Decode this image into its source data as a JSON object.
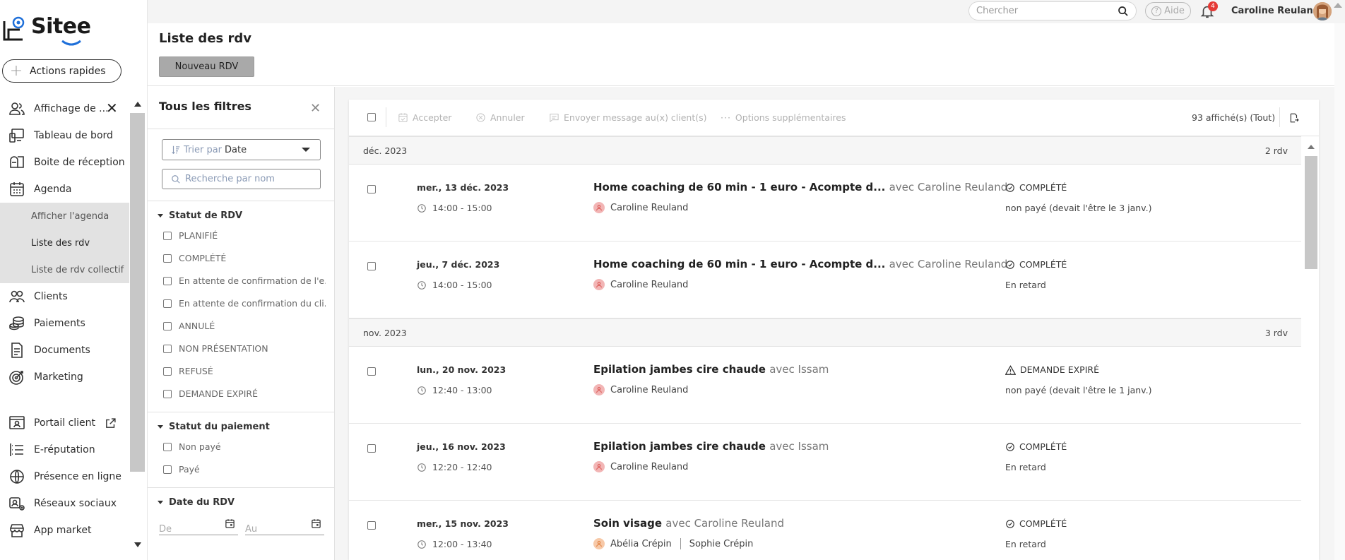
{
  "app": {
    "brand": "Sitee"
  },
  "sidebar": {
    "quick_actions": "Actions rapides",
    "items": [
      {
        "label": "Affichage de ...",
        "icon": "users-icon",
        "closable": true
      },
      {
        "label": "Tableau de bord",
        "icon": "dashboard-icon"
      },
      {
        "label": "Boite de réception",
        "icon": "mailbox-icon"
      },
      {
        "label": "Agenda",
        "icon": "calendar-icon"
      },
      {
        "label": "Clients",
        "icon": "clients-icon"
      },
      {
        "label": "Paiements",
        "icon": "coins-icon"
      },
      {
        "label": "Documents",
        "icon": "document-icon"
      },
      {
        "label": "Marketing",
        "icon": "target-icon"
      },
      {
        "label": "Portail client",
        "icon": "portal-icon",
        "external": true
      },
      {
        "label": "E-réputation",
        "icon": "reputation-icon"
      },
      {
        "label": "Présence en ligne",
        "icon": "globe-icon"
      },
      {
        "label": "Réseaux sociaux",
        "icon": "social-icon"
      },
      {
        "label": "App market",
        "icon": "store-icon"
      }
    ],
    "agenda_sub": [
      "Afficher l'agenda",
      "Liste des rdv",
      "Liste de rdv collectif"
    ]
  },
  "topbar": {
    "search_placeholder": "Chercher",
    "help": "Aide",
    "notifications": "4",
    "user": "Caroline Reuland"
  },
  "header": {
    "title": "Liste des rdv",
    "new_button": "Nouveau RDV"
  },
  "filters": {
    "title": "Tous les filtres",
    "sort_label": "Trier par",
    "sort_value": "Date",
    "name_search_placeholder": "Recherche par nom",
    "sections": [
      {
        "title": "Statut de RDV",
        "options": [
          "PLANIFIÉ",
          "COMPLÉTÉ",
          "En attente de confirmation de l'e...",
          "En attente de confirmation du cli...",
          "ANNULÉ",
          "NON PRÉSENTATION",
          "REFUSÉ",
          "DEMANDE EXPIRÉ"
        ]
      },
      {
        "title": "Statut du paiement",
        "options": [
          "Non payé",
          "Payé"
        ]
      },
      {
        "title": "Date du RDV",
        "from": "De",
        "to": "Au"
      }
    ]
  },
  "toolbar": {
    "accept": "Accepter",
    "cancel": "Annuler",
    "message": "Envoyer message au(x) client(s)",
    "more": "Options supplémentaires",
    "count": "93 affiché(s) (Tout)"
  },
  "groups": [
    {
      "month": "déc. 2023",
      "count": "2 rdv",
      "rows": [
        {
          "date": "mer., 13 déc. 2023",
          "time": "14:00 - 15:00",
          "service": "Home coaching de 60 min - 1 euro - Acompte d...",
          "with": "avec Caroline Reuland",
          "client": "Caroline Reuland",
          "status": "COMPLÉTÉ",
          "status_icon": "check-circle-icon",
          "payment": "non payé (devait l'être le 3 janv.)"
        },
        {
          "date": "jeu., 7 déc. 2023",
          "time": "14:00 - 15:00",
          "service": "Home coaching de 60 min - 1 euro - Acompte d...",
          "with": "avec Caroline Reuland",
          "client": "Caroline Reuland",
          "status": "COMPLÉTÉ",
          "status_icon": "check-circle-icon",
          "payment": "En retard"
        }
      ]
    },
    {
      "month": "nov. 2023",
      "count": "3 rdv",
      "rows": [
        {
          "date": "lun., 20 nov. 2023",
          "time": "12:40 - 13:00",
          "service": "Epilation jambes cire chaude",
          "with": "avec Issam",
          "client": "Caroline Reuland",
          "status": "DEMANDE EXPIRÉ",
          "status_icon": "warning-icon",
          "payment": "non payé (devait l'être le 1 janv.)"
        },
        {
          "date": "jeu., 16 nov. 2023",
          "time": "12:20 - 12:40",
          "service": "Epilation jambes cire chaude",
          "with": "avec Issam",
          "client": "Caroline Reuland",
          "status": "COMPLÉTÉ",
          "status_icon": "check-circle-icon",
          "payment": "En retard"
        },
        {
          "date": "mer., 15 nov. 2023",
          "time": "12:00 - 13:40",
          "service": "Soin visage",
          "with": "avec Caroline Reuland",
          "client": "Abélia Crépin",
          "client2": "Sophie Crépin",
          "status": "COMPLÉTÉ",
          "status_icon": "check-circle-icon",
          "payment": "En retard"
        }
      ]
    }
  ],
  "colors": {
    "accent_blue": "#1e6fd9",
    "badge_red": "#e53935",
    "button_grey": "#a9a9a9"
  }
}
